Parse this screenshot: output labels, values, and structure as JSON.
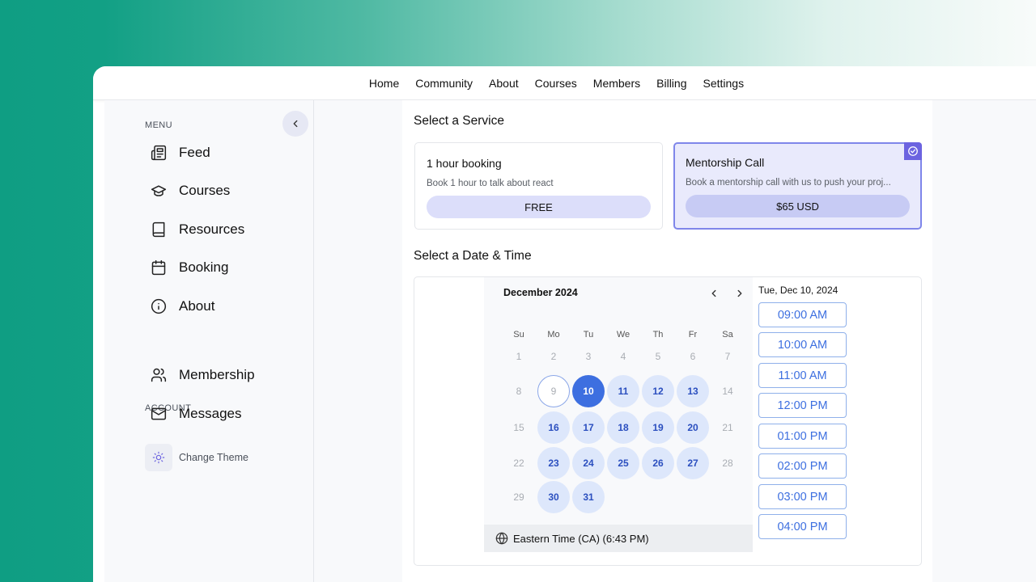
{
  "topnav": {
    "items": [
      "Home",
      "Community",
      "About",
      "Courses",
      "Members",
      "Billing",
      "Settings"
    ]
  },
  "sidebar": {
    "menu_label": "MENU",
    "account_label": "ACCOUNT",
    "menu_items": [
      {
        "label": "Feed",
        "icon": "newspaper-icon"
      },
      {
        "label": "Courses",
        "icon": "graduation-cap-icon"
      },
      {
        "label": "Resources",
        "icon": "book-icon"
      },
      {
        "label": "Booking",
        "icon": "calendar-icon"
      },
      {
        "label": "About",
        "icon": "info-icon"
      }
    ],
    "account_items": [
      {
        "label": "Membership",
        "icon": "users-icon"
      },
      {
        "label": "Messages",
        "icon": "mail-icon"
      }
    ],
    "theme_label": "Change Theme"
  },
  "service": {
    "heading": "Select a Service",
    "cards": [
      {
        "title": "1 hour booking",
        "description": "Book 1 hour to talk about react",
        "price": "FREE",
        "selected": false
      },
      {
        "title": "Mentorship Call",
        "description": "Book a mentorship call with us to push your proj...",
        "price": "$65 USD",
        "selected": true
      }
    ]
  },
  "datetime": {
    "heading": "Select a Date & Time",
    "month": "December 2024",
    "weekdays": [
      "Su",
      "Mo",
      "Tu",
      "We",
      "Th",
      "Fr",
      "Sa"
    ],
    "weeks": [
      [
        "1",
        "2",
        "3",
        "4",
        "5",
        "6",
        "7"
      ],
      [
        "8",
        "9",
        "10",
        "11",
        "12",
        "13",
        "14"
      ],
      [
        "15",
        "16",
        "17",
        "18",
        "19",
        "20",
        "21"
      ],
      [
        "22",
        "23",
        "24",
        "25",
        "26",
        "27",
        "28"
      ],
      [
        "29",
        "30",
        "31",
        "",
        "",
        "",
        ""
      ]
    ],
    "available_days": [
      "11",
      "12",
      "13",
      "16",
      "17",
      "18",
      "19",
      "20",
      "23",
      "24",
      "25",
      "26",
      "27",
      "30",
      "31"
    ],
    "selected_day": "10",
    "today": "9",
    "timezone": "Eastern Time (CA) (6:43 PM)",
    "selected_date_label": "Tue, Dec 10, 2024",
    "slots": [
      "09:00 AM",
      "10:00 AM",
      "11:00 AM",
      "12:00 PM",
      "01:00 PM",
      "02:00 PM",
      "03:00 PM",
      "04:00 PM"
    ]
  },
  "colors": {
    "accent": "#3d6fe0",
    "selected_card": "#7f86ea",
    "brand_gradient": "#0f9e83"
  }
}
